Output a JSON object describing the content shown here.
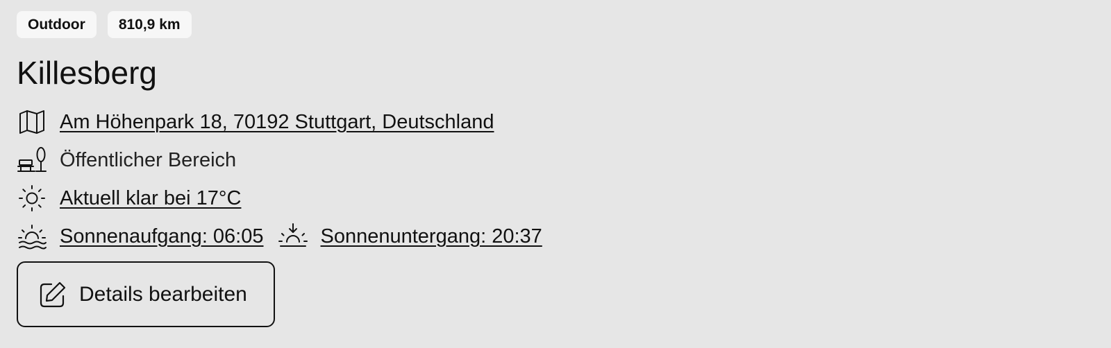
{
  "badges": {
    "category": "Outdoor",
    "distance": "810,9 km"
  },
  "location": {
    "name": "Killesberg",
    "address": "Am Höhenpark 18, 70192 Stuttgart, Deutschland",
    "area_type": "Öffentlicher Bereich",
    "weather": "Aktuell klar bei 17°C",
    "sunrise": "Sonnenaufgang: 06:05",
    "sunset": "Sonnenuntergang: 20:37"
  },
  "actions": {
    "edit_label": "Details bearbeiten"
  },
  "icons": {
    "address": "map-icon",
    "area": "park-bench-tree-icon",
    "weather": "sun-icon",
    "sunrise": "sunrise-icon",
    "sunset": "sunset-icon",
    "edit": "edit-pencil-icon"
  }
}
